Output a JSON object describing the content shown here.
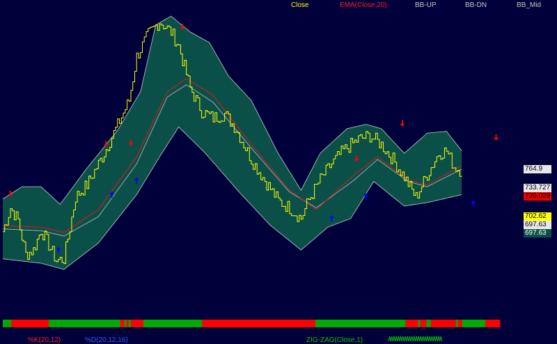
{
  "legend": {
    "close": "Close",
    "ema": "EMA(Close,20)",
    "bb_up": "BB-UP",
    "bb_dn": "BB-DN",
    "bb_mid": "BB_Mid"
  },
  "price_tags": [
    {
      "text": "764.9",
      "bg": "#e8e8e8",
      "fg": "#000000"
    },
    {
      "text": "733.727",
      "bg": "#e8e8e8",
      "fg": "#000000"
    },
    {
      "text": "730.029",
      "bg": "#e80000",
      "fg": "#000000"
    },
    {
      "text": "702.62",
      "bg": "#ffff00",
      "fg": "#000000"
    },
    {
      "text": "697.63",
      "bg": "#e8e8e8",
      "fg": "#000000"
    },
    {
      "text": "697.63",
      "bg": "#0b5048",
      "fg": "#ffffff"
    }
  ],
  "bottom_labels": {
    "stoch_k": "%K(20,12)",
    "stoch_d": "%D(20,12,16)",
    "zigzag": "ZIG-ZAG(Close,1)"
  },
  "colors": {
    "background": "#00003a",
    "band_fill": "#0b5048",
    "band_edge": "#c8d0d0",
    "close": "#ffff00",
    "ema": "#e01818",
    "bb_mid": "#b0b0b0",
    "sell_arrow": "#ff0000",
    "buy_arrow": "#0000ff",
    "strip_up": "#00aa00",
    "strip_down": "#ff0000"
  },
  "chart_data": {
    "type": "line",
    "x_count": 120,
    "series": [
      {
        "name": "Close",
        "anchors": [
          [
            0,
            653
          ],
          [
            4,
            680
          ],
          [
            8,
            666
          ],
          [
            12,
            627
          ],
          [
            16,
            632
          ],
          [
            20,
            655
          ],
          [
            24,
            638
          ],
          [
            28,
            620
          ],
          [
            32,
            622
          ],
          [
            38,
            692
          ],
          [
            44,
            706
          ],
          [
            52,
            738
          ],
          [
            60,
            774
          ],
          [
            66,
            802
          ],
          [
            70,
            852
          ],
          [
            76,
            877
          ],
          [
            82,
            892
          ],
          [
            88,
            880
          ],
          [
            92,
            864
          ],
          [
            98,
            816
          ],
          [
            104,
            790
          ],
          [
            110,
            782
          ],
          [
            116,
            787
          ],
          [
            122,
            770
          ],
          [
            130,
            735
          ],
          [
            138,
            708
          ],
          [
            144,
            688
          ],
          [
            150,
            680
          ],
          [
            156,
            668
          ],
          [
            160,
            689
          ],
          [
            166,
            712
          ],
          [
            172,
            730
          ],
          [
            178,
            745
          ],
          [
            186,
            758
          ],
          [
            192,
            762
          ],
          [
            198,
            752
          ],
          [
            204,
            735
          ],
          [
            210,
            715
          ],
          [
            216,
            692
          ],
          [
            222,
            718
          ],
          [
            228,
            742
          ],
          [
            232,
            745
          ],
          [
            236,
            727
          ],
          [
            240,
            722
          ]
        ]
      },
      {
        "name": "EMA(Close,20)",
        "anchors": [
          [
            0,
            660
          ],
          [
            20,
            658
          ],
          [
            32,
            652
          ],
          [
            50,
            678
          ],
          [
            70,
            738
          ],
          [
            86,
            812
          ],
          [
            96,
            827
          ],
          [
            110,
            808
          ],
          [
            130,
            752
          ],
          [
            150,
            700
          ],
          [
            164,
            678
          ],
          [
            184,
            718
          ],
          [
            196,
            738
          ],
          [
            212,
            712
          ],
          [
            222,
            706
          ],
          [
            240,
            728
          ]
        ]
      },
      {
        "name": "BB-UP",
        "anchors": [
          [
            0,
            690
          ],
          [
            10,
            704
          ],
          [
            20,
            704
          ],
          [
            30,
            684
          ],
          [
            44,
            725
          ],
          [
            60,
            768
          ],
          [
            72,
            812
          ],
          [
            80,
            888
          ],
          [
            88,
            898
          ],
          [
            98,
            880
          ],
          [
            108,
            868
          ],
          [
            118,
            830
          ],
          [
            130,
            802
          ],
          [
            144,
            742
          ],
          [
            156,
            700
          ],
          [
            166,
            742
          ],
          [
            180,
            770
          ],
          [
            190,
            775
          ],
          [
            198,
            770
          ],
          [
            210,
            742
          ],
          [
            222,
            765
          ],
          [
            232,
            767
          ],
          [
            240,
            745
          ]
        ]
      },
      {
        "name": "BB-DN",
        "anchors": [
          [
            0,
            622
          ],
          [
            20,
            617
          ],
          [
            32,
            610
          ],
          [
            50,
            640
          ],
          [
            70,
            695
          ],
          [
            82,
            738
          ],
          [
            92,
            772
          ],
          [
            106,
            742
          ],
          [
            124,
            697
          ],
          [
            140,
            660
          ],
          [
            156,
            632
          ],
          [
            170,
            658
          ],
          [
            182,
            668
          ],
          [
            194,
            710
          ],
          [
            210,
            682
          ],
          [
            222,
            686
          ],
          [
            240,
            695
          ]
        ]
      },
      {
        "name": "BB_Mid",
        "anchors": [
          [
            0,
            656
          ],
          [
            20,
            654
          ],
          [
            32,
            648
          ],
          [
            50,
            670
          ],
          [
            70,
            730
          ],
          [
            86,
            806
          ],
          [
            96,
            820
          ],
          [
            110,
            800
          ],
          [
            130,
            748
          ],
          [
            150,
            698
          ],
          [
            164,
            680
          ],
          [
            184,
            712
          ],
          [
            196,
            735
          ],
          [
            212,
            710
          ],
          [
            222,
            704
          ],
          [
            240,
            724
          ]
        ]
      }
    ],
    "signals": [
      {
        "type": "sell",
        "x": 4,
        "y": 694
      },
      {
        "type": "buy",
        "x": 29,
        "y": 634
      },
      {
        "type": "sell",
        "x": 54,
        "y": 751
      },
      {
        "type": "buy",
        "x": 57,
        "y": 697
      },
      {
        "type": "sell",
        "x": 67,
        "y": 752
      },
      {
        "type": "buy",
        "x": 70,
        "y": 713
      },
      {
        "type": "sell",
        "x": 94,
        "y": 884
      },
      {
        "type": "buy",
        "x": 172,
        "y": 670
      },
      {
        "type": "sell",
        "x": 185,
        "y": 734
      },
      {
        "type": "buy",
        "x": 190,
        "y": 695
      },
      {
        "type": "sell",
        "x": 209,
        "y": 774
      },
      {
        "type": "buy",
        "x": 246,
        "y": 687
      },
      {
        "type": "sell",
        "x": 258,
        "y": 758
      }
    ],
    "strip": [
      "up",
      "up",
      "up",
      "up",
      "down",
      "down",
      "down",
      "down",
      "down",
      "down",
      "down",
      "down",
      "down",
      "down",
      "down",
      "down",
      "down",
      "down",
      "down",
      "down",
      "down",
      "down",
      "up",
      "up",
      "up",
      "up",
      "up",
      "up",
      "up",
      "up",
      "up",
      "up",
      "up",
      "up",
      "up",
      "up",
      "up",
      "up",
      "up",
      "up",
      "up",
      "up",
      "up",
      "up",
      "up",
      "up",
      "up",
      "up",
      "up",
      "up",
      "up",
      "up",
      "up",
      "up",
      "up",
      "up",
      "down",
      "down",
      "up",
      "down",
      "up",
      "down",
      "down",
      "down",
      "down",
      "down",
      "down",
      "up",
      "up",
      "up",
      "up",
      "up",
      "up",
      "up",
      "up",
      "up",
      "up",
      "up",
      "up",
      "up",
      "up",
      "up",
      "up",
      "up",
      "up",
      "up",
      "up",
      "up",
      "up",
      "up",
      "up",
      "up",
      "up",
      "up",
      "up",
      "down",
      "down",
      "down",
      "down",
      "down",
      "down",
      "down",
      "down",
      "down",
      "down",
      "down",
      "down",
      "down",
      "down",
      "down",
      "down",
      "down",
      "down",
      "down",
      "down",
      "down",
      "down",
      "down",
      "down",
      "down",
      "down",
      "down",
      "down",
      "down",
      "down",
      "down",
      "down",
      "down",
      "down",
      "down",
      "down",
      "down",
      "down",
      "down",
      "down",
      "down",
      "down",
      "down",
      "down",
      "down",
      "down",
      "down",
      "down",
      "down",
      "down",
      "down",
      "down",
      "down",
      "down",
      "up",
      "up",
      "up",
      "up",
      "up",
      "up",
      "up",
      "up",
      "up",
      "up",
      "up",
      "up",
      "up",
      "up",
      "up",
      "up",
      "up",
      "up",
      "up",
      "up",
      "up",
      "up",
      "up",
      "up",
      "up",
      "up",
      "up",
      "up",
      "up",
      "up",
      "up",
      "up",
      "up",
      "up",
      "up",
      "up",
      "up",
      "up",
      "up",
      "up",
      "up",
      "up",
      "up",
      "down",
      "down",
      "down",
      "down",
      "down",
      "down",
      "up",
      "down",
      "down",
      "down",
      "up",
      "up",
      "down",
      "down",
      "down",
      "down",
      "down",
      "down",
      "down",
      "down",
      "down",
      "down",
      "down",
      "down",
      "up",
      "down",
      "down",
      "up",
      "up",
      "up",
      "up",
      "up",
      "up",
      "up",
      "up",
      "up",
      "up",
      "up",
      "down",
      "down",
      "down",
      "down",
      "down",
      "down",
      "down"
    ],
    "y_min": 560,
    "y_max": 910,
    "x_max": 260
  }
}
